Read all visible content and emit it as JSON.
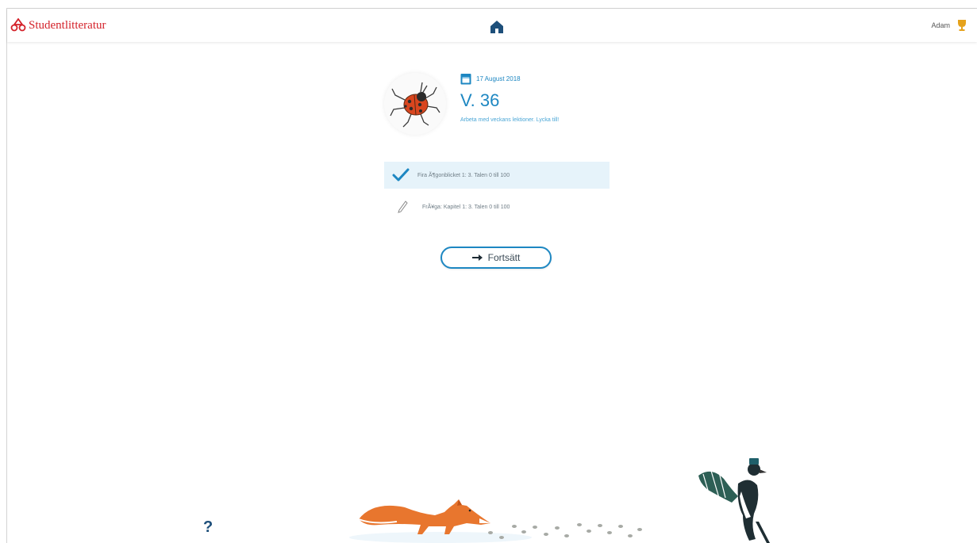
{
  "header": {
    "logo_text": "Studentlitteratur",
    "user_name": "Adam"
  },
  "lesson": {
    "date": "17 August 2018",
    "week": "V. 36",
    "description": "Arbeta med veckans lektioner. Lycka till!"
  },
  "tasks": [
    {
      "label": "Fira Ã¶gonblicket 1: 3. Talen 0 till 100",
      "status": "done"
    },
    {
      "label": "FrÃ¥ga: Kapitel 1: 3. Talen 0 till 100",
      "status": "todo"
    }
  ],
  "continue_label": "Fortsätt",
  "help_label": "?",
  "colors": {
    "brand": "#d4222a",
    "accent": "#1d87c2",
    "done_bg": "#e6f3fa",
    "trophy": "#e5a21c"
  }
}
